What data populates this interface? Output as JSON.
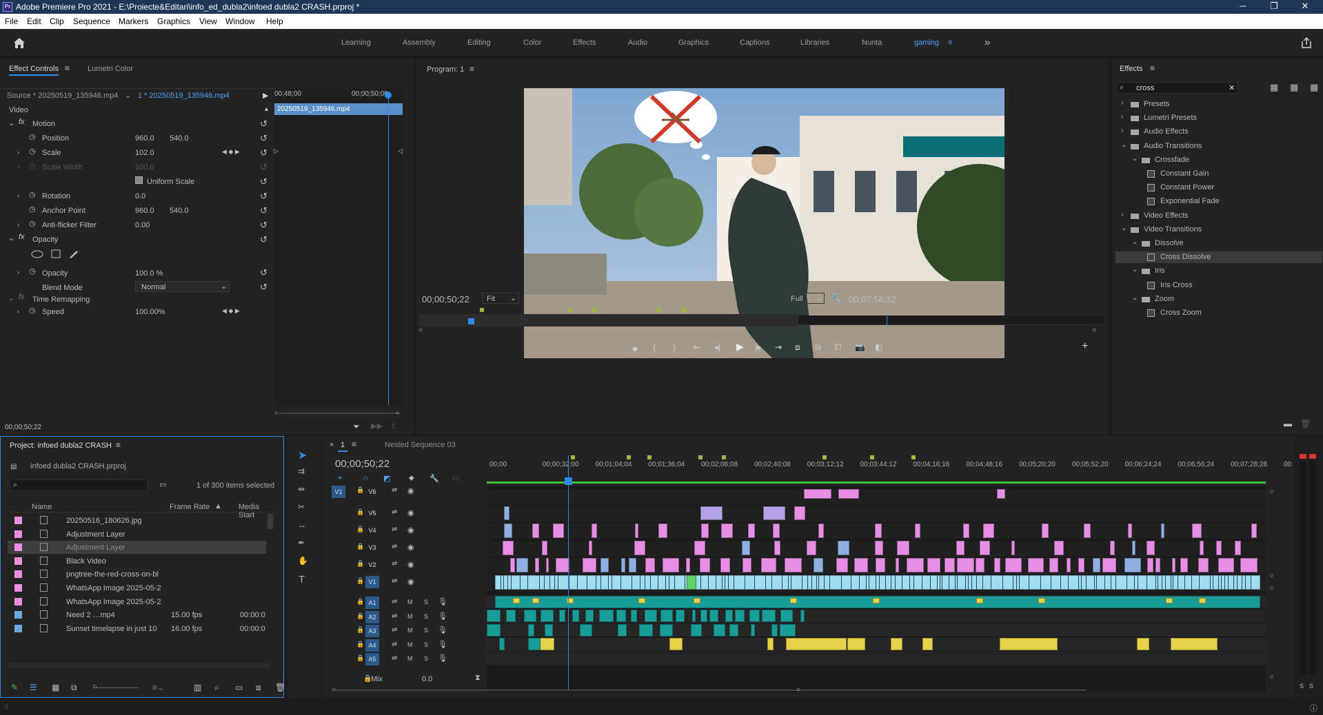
{
  "app": {
    "logo": "Pr",
    "title": "Adobe Premiere Pro 2021 - E:\\Proiecte&Editari\\info_ed_dubla2\\infoed dubla2 CRASH.prproj *",
    "minimize": "─",
    "restore": "❐",
    "close": "✕"
  },
  "menu": [
    "File",
    "Edit",
    "Clip",
    "Sequence",
    "Markers",
    "Graphics",
    "View",
    "Window",
    "Help"
  ],
  "workspaces": [
    "Learning",
    "Assembly",
    "Editing",
    "Color",
    "Effects",
    "Audio",
    "Graphics",
    "Captions",
    "Libraries",
    "Nunta",
    "gaming"
  ],
  "workspace_more": "»",
  "effect_controls": {
    "tab1": "Effect Controls",
    "tab2": "Lumetri Color",
    "source": "Source * 20250519_135946.mp4",
    "seq": "1 * 20250519_135946.mp4",
    "t1": "00;48;00",
    "t2": "00;00;50;00",
    "clip": "20250519_135946.mp4",
    "section": "Video",
    "motion": "Motion",
    "position": "Position",
    "pos_x": "960.0",
    "pos_y": "540.0",
    "scale": "Scale",
    "scale_v": "102.0",
    "scale_width": "Scale Width",
    "scale_width_v": "100.0",
    "uniform": "Uniform Scale",
    "rotation": "Rotation",
    "rotation_v": "0.0",
    "anchor": "Anchor Point",
    "anc_x": "960.0",
    "anc_y": "540.0",
    "antiflicker": "Anti-flicker Filter",
    "antiflicker_v": "0.00",
    "opacity": "Opacity",
    "opacity_v": "100.0 %",
    "blend": "Blend Mode",
    "blend_v": "Normal",
    "time_remap": "Time Remapping",
    "speed": "Speed",
    "speed_v": "100.00%",
    "timecode": "00;00;50;22"
  },
  "program": {
    "title": "Program: 1",
    "timecode": "00;00;50;22",
    "fit": "Fit",
    "full": "Full",
    "duration": "00;07;58;32"
  },
  "effects": {
    "title": "Effects",
    "search": "cross",
    "items": [
      {
        "label": "Presets",
        "lvl": 0,
        "kind": "closed"
      },
      {
        "label": "Lumetri Presets",
        "lvl": 0,
        "kind": "closed"
      },
      {
        "label": "Audio Effects",
        "lvl": 0,
        "kind": "closed"
      },
      {
        "label": "Audio Transitions",
        "lvl": 0,
        "kind": "open"
      },
      {
        "label": "Crossfade",
        "lvl": 1,
        "kind": "folder"
      },
      {
        "label": "Constant Gain",
        "lvl": 2,
        "kind": "fx"
      },
      {
        "label": "Constant Power",
        "lvl": 2,
        "kind": "fx"
      },
      {
        "label": "Exponential Fade",
        "lvl": 2,
        "kind": "fx"
      },
      {
        "label": "Video Effects",
        "lvl": 0,
        "kind": "closed"
      },
      {
        "label": "Video Transitions",
        "lvl": 0,
        "kind": "open"
      },
      {
        "label": "Dissolve",
        "lvl": 1,
        "kind": "folder"
      },
      {
        "label": "Cross Dissolve",
        "lvl": 2,
        "kind": "fx",
        "selected": true
      },
      {
        "label": "Iris",
        "lvl": 1,
        "kind": "folder"
      },
      {
        "label": "Iris Cross",
        "lvl": 2,
        "kind": "fx"
      },
      {
        "label": "Zoom",
        "lvl": 1,
        "kind": "folder"
      },
      {
        "label": "Cross Zoom",
        "lvl": 2,
        "kind": "fx"
      }
    ]
  },
  "project": {
    "title": "Project: infoed dubla2 CRASH",
    "file": "infoed dubla2 CRASH.prproj",
    "count": "1 of 300 items selected",
    "cols": [
      "Name",
      "Frame Rate",
      "Media Start"
    ],
    "rows": [
      {
        "name": "20250516_180626.jpg",
        "fps": "",
        "start": "",
        "color": "#e98ee0"
      },
      {
        "name": "Adjustment Layer",
        "fps": "",
        "start": "",
        "color": "#e98ee0"
      },
      {
        "name": "Adjustment Layer",
        "fps": "",
        "start": "",
        "color": "#e98ee0",
        "selected": true
      },
      {
        "name": "Black Video",
        "fps": "",
        "start": "",
        "color": "#e98ee0"
      },
      {
        "name": "pngtree-the-red-cross-on-bl",
        "fps": "",
        "start": "",
        "color": "#e98ee0"
      },
      {
        "name": "WhatsApp Image 2025-05-2",
        "fps": "",
        "start": "",
        "color": "#e98ee0"
      },
      {
        "name": "WhatsApp Image 2025-05-2",
        "fps": "",
        "start": "",
        "color": "#e98ee0"
      },
      {
        "name": "Need 2 …mp4",
        "fps": "15.00 fps",
        "start": "00:00:0",
        "color": "#6aa9e0"
      },
      {
        "name": "Sunset timelapse in just 10",
        "fps": "16.00 fps",
        "start": "00:00:0",
        "color": "#6aa9e0"
      }
    ]
  },
  "timeline": {
    "tab": "1",
    "nested": "Nested Sequence 03",
    "timecode": "00;00;50;22",
    "ruler": [
      "00;00",
      "00;00;32;00",
      "00;01;04;04",
      "00;01;36;04",
      "00;02;08;08",
      "00;02;40;08",
      "00;03;12;12",
      "00;03;44;12",
      "00;04;16;16",
      "00;04;48;16",
      "00;05;20;20",
      "00;05;52;20",
      "00;06;24;24",
      "00;06;56;24",
      "00;07;28;28",
      "00"
    ],
    "video_tracks": [
      "V6",
      "V5",
      "V4",
      "V3",
      "V2",
      "V1"
    ],
    "audio_tracks": [
      "A1",
      "A2",
      "A3",
      "A4",
      "A5"
    ],
    "mix": "Mix",
    "mix_v": "0.0",
    "source_patch": "V1",
    "m": "M",
    "s": "S"
  },
  "colors": {
    "accent": "#2d8ceb",
    "pink": "#e68ee3",
    "lavender": "#b3a2e8",
    "cyan": "#9fdcf0",
    "teal": "#1a9d98",
    "yellow": "#e6d34a"
  }
}
